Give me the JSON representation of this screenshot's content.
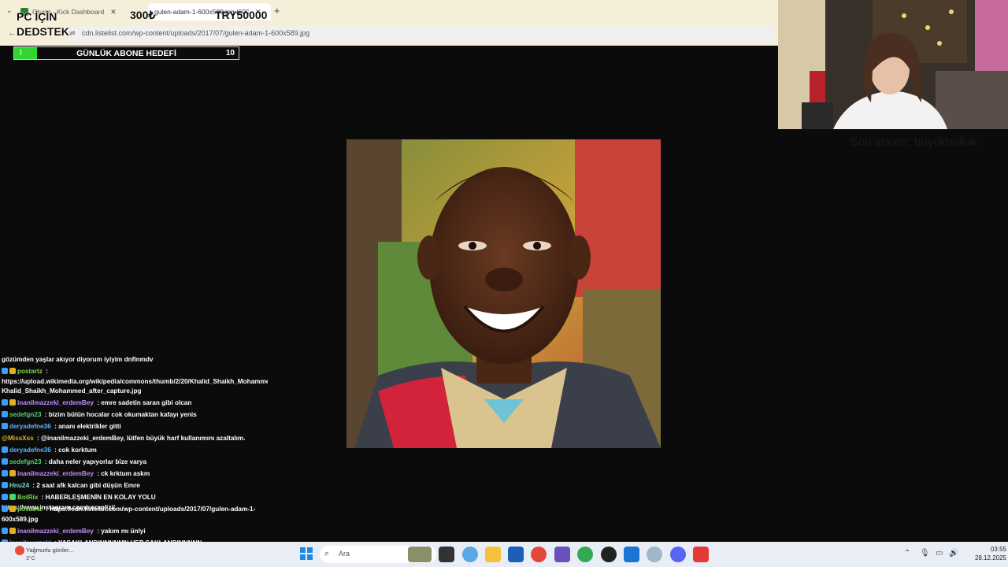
{
  "browser": {
    "tabs": [
      {
        "label": "Oturm - Kick Dashboard",
        "active": false
      },
      {
        "label": "gulen-adam-1-600x589.jpg (600...",
        "active": true
      }
    ],
    "new_tab_symbol": "+",
    "url": "cdn.listelist.com/wp-content/uploads/2017/07/gulen-adam-1-600x589.jpg"
  },
  "overlay": {
    "pc_line1": "PC İÇİN",
    "pc_line2": "DEDSTEK",
    "amount_a": "300₺",
    "amount_b": "TRY50000"
  },
  "goal": {
    "title": "GÜNLÜK ABONE HEDEFİ",
    "current": "1",
    "target": "10",
    "progress": 0.1,
    "fill_color": "#2fd62f"
  },
  "sub_text": "Son abone: büyükbulluk",
  "chat": [
    {
      "user": "",
      "user_color": "#ffffff",
      "text": "gözümden yaşlar akıyor diyorum iyiyim dnflnmdv",
      "badges": []
    },
    {
      "user": "postartz",
      "user_color": "#7bd64b",
      "text": " : https://upload.wikimedia.org/wikipedia/commons/thumb/2/20/Khalid_Shaikh_Mohammed_after_capture.jpg/1200px-Khalid_Shaikh_Mohammed_after_capture.jpg",
      "badges": [
        "#3aa0ff",
        "#e0b020"
      ]
    },
    {
      "user": "inanilmazzeki_erdemBey",
      "user_color": "#c58bff",
      "text": " : emre sadetin saran gibi olcan",
      "badges": [
        "#3aa0ff",
        "#e0b020"
      ]
    },
    {
      "user": "sedefgn23",
      "user_color": "#4bd66b",
      "text": " : bizim bütün hocalar cok okumaktan kafayı yenis",
      "badges": [
        "#3aa0ff"
      ]
    },
    {
      "user": "deryadefne36",
      "user_color": "#5ab4ff",
      "text": " : ananı elektrikler gitti",
      "badges": [
        "#3aa0ff"
      ]
    },
    {
      "user": "@MissXss",
      "user_color": "#e0b020",
      "text": " : @inanilmazzeki_erdemBey, lütfen büyük harf kullanımını azaltalım.",
      "badges": []
    },
    {
      "user": "deryadefne36",
      "user_color": "#5ab4ff",
      "text": " : cok korktum",
      "badges": [
        "#3aa0ff"
      ]
    },
    {
      "user": "sedefgn23",
      "user_color": "#4bd66b",
      "text": " : daha neler yapıyorlar bize varya",
      "badges": [
        "#3aa0ff"
      ]
    },
    {
      "user": "inanilmazzeki_erdemBey",
      "user_color": "#c58bff",
      "text": " : ck krktum askm",
      "badges": [
        "#3aa0ff",
        "#e0b020"
      ]
    },
    {
      "user": "Hnu24",
      "user_color": "#7bd6c4",
      "text": " : 2 saat afk kalcan gibi düşün Emre",
      "badges": [
        "#3aa0ff"
      ]
    },
    {
      "user": "BotRix",
      "user_color": "#7bd64b",
      "text": " : HABERLEŞMENİN EN KOLAY YOLU https://www.instagram.com/seraplizi/",
      "badges": [
        "#3aa0ff",
        "#4bd66b"
      ]
    },
    {
      "user": "postartz",
      "user_color": "#7bd64b",
      "text": " : https://cdn.listelist.com/wp-content/uploads/2017/07/gulen-adam-1-600x589.jpg",
      "badges": [
        "#3aa0ff",
        "#e0b020"
      ]
    },
    {
      "user": "inanilmazzeki_erdemBey",
      "user_color": "#c58bff",
      "text": " : yakım mı ünlyi",
      "badges": [
        "#3aa0ff",
        "#e0b020"
      ]
    },
    {
      "user": "inanilmazzeki",
      "user_color": "#5ab4ff",
      "text": " : YASAKLANDINNNNMN HEP SAKLANDINNNNN",
      "badges": [
        "#3aa0ff"
      ]
    }
  ],
  "taskbar": {
    "search_placeholder": "Ara",
    "weather_text": "Yağmurlu günler...",
    "weather_temp": "3°C",
    "weather_badge": "6",
    "time": "03:55",
    "date": "28.12.2025",
    "icons": [
      "windows-start-icon",
      "search-icon",
      "task-view-icon",
      "file-icon",
      "copilot-icon",
      "folder-icon",
      "store-icon",
      "chrome-icon",
      "app-icon",
      "chrome-alt-icon",
      "obs-icon",
      "mail-icon",
      "settings-icon",
      "discord-icon",
      "youtube-icon"
    ]
  }
}
